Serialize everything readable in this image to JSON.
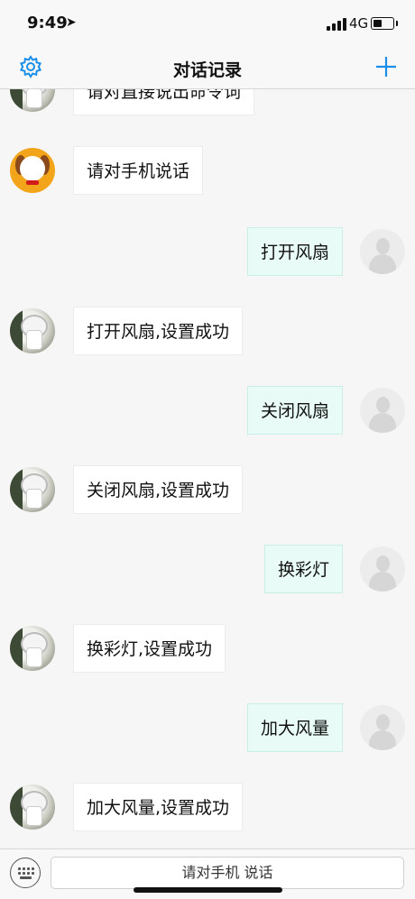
{
  "status": {
    "time": "9:49",
    "location_glyph": "➤",
    "network": "4G"
  },
  "nav": {
    "title": "对话记录",
    "settings_icon": "gear-icon",
    "add_icon": "plus-icon",
    "accent_color": "#1a8ee8"
  },
  "messages": [
    {
      "side": "left",
      "avatar": "fan",
      "text": "请对直接说出命令词"
    },
    {
      "side": "left",
      "avatar": "dog",
      "text": "请对手机说话"
    },
    {
      "side": "right",
      "avatar": "user",
      "text": "打开风扇"
    },
    {
      "side": "left",
      "avatar": "fan",
      "text": "打开风扇,设置成功"
    },
    {
      "side": "right",
      "avatar": "user",
      "text": "关闭风扇"
    },
    {
      "side": "left",
      "avatar": "fan",
      "text": "关闭风扇,设置成功"
    },
    {
      "side": "right",
      "avatar": "user",
      "text": "换彩灯"
    },
    {
      "side": "left",
      "avatar": "fan",
      "text": "换彩灯,设置成功"
    },
    {
      "side": "right",
      "avatar": "user",
      "text": "加大风量"
    },
    {
      "side": "left",
      "avatar": "fan",
      "text": "加大风量,设置成功"
    }
  ],
  "input": {
    "speak_label": "请对手机 说话"
  }
}
